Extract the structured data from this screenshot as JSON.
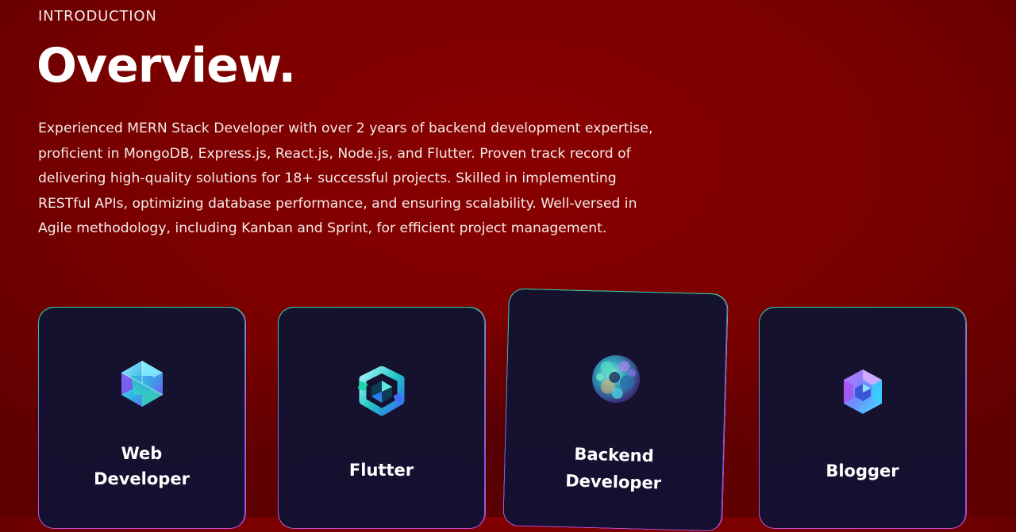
{
  "about": {
    "subtitle": "INTRODUCTION",
    "heading": "Overview.",
    "description": "Experienced MERN Stack Developer with over 2 years of backend development expertise, proficient in MongoDB, Express.js, React.js, Node.js, and Flutter. Proven track record of delivering high-quality solutions for 18+ successful projects. Skilled in implementing RESTful APIs, optimizing database performance, and ensuring scalability. Well-versed in Agile methodology, including Kanban and Sprint, for efficient project management."
  },
  "services": [
    {
      "title_line1": "Web",
      "title_line2": "Developer",
      "icon": "web-developer-icon"
    },
    {
      "title": "Flutter",
      "icon": "flutter-icon"
    },
    {
      "title_line1": "Backend",
      "title_line2": "Developer",
      "icon": "backend-developer-icon"
    },
    {
      "title": "Blogger",
      "icon": "blogger-icon"
    }
  ],
  "colors": {
    "background": "#800000",
    "card_background": "#151030",
    "border_top": "#3fc9a9",
    "border_bottom": "#c44fdd"
  }
}
